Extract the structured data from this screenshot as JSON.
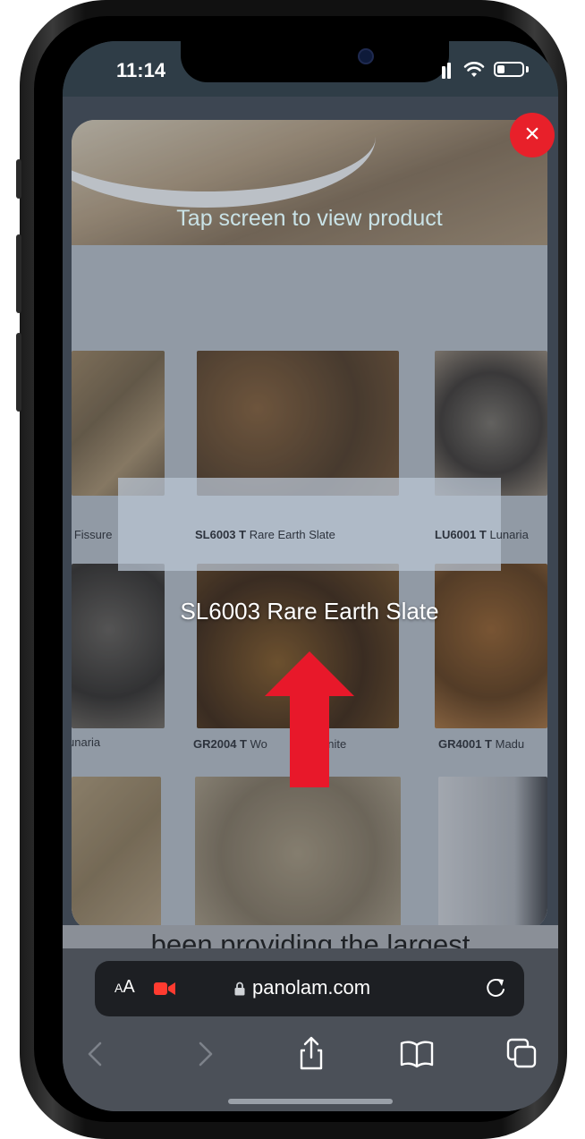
{
  "status_bar": {
    "time": "11:14"
  },
  "ar_view": {
    "hint": "Tap screen to view product",
    "product_title": "SL6003 Rare Earth Slate",
    "close_label": "×",
    "sample_labels": {
      "left_top": "n Fissure",
      "center_top_code": "SL6003 T",
      "center_top_name": "Rare Earth Slate",
      "right_top_code": "LU6001 T",
      "right_top_name": "Lunaria",
      "left_bottom": "unaria",
      "center_bottom_code": "GR2004 T",
      "center_bottom_name": "Wo",
      "center_bottom_suffix": "k Granite",
      "right_bottom_code": "GR4001 T",
      "right_bottom_name": "Madu"
    }
  },
  "page": {
    "background_text": "been providing the largest"
  },
  "safari": {
    "aa_small": "A",
    "aa_large": "A",
    "url": "panolam.com"
  },
  "colors": {
    "close": "#e8202a",
    "arrow": "#e8182a",
    "recording": "#ff3b30"
  },
  "icons": {
    "close": "close-icon",
    "lock": "lock-icon",
    "reload": "reload-icon",
    "back": "back-arrow-icon",
    "forward": "forward-arrow-icon",
    "share": "share-icon",
    "bookmarks": "book-icon",
    "tabs": "tabs-icon",
    "camera": "video-camera-icon"
  }
}
